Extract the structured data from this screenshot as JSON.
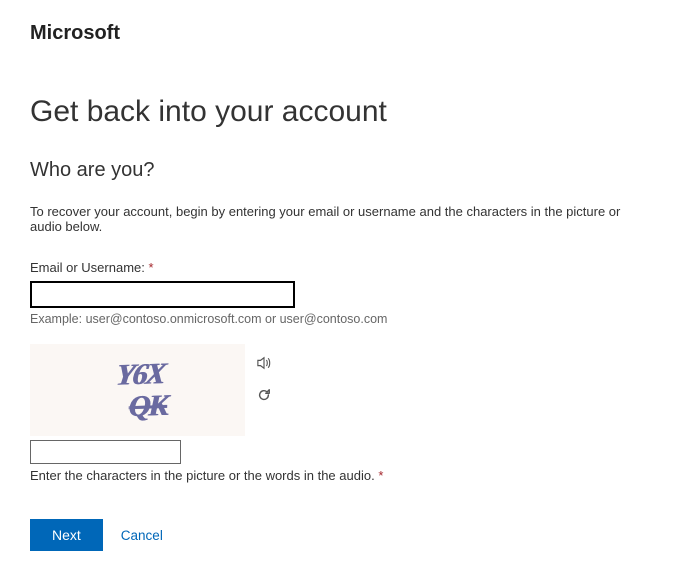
{
  "brand": "Microsoft",
  "page_title": "Get back into your account",
  "subtitle": "Who are you?",
  "instructions": "To recover your account, begin by entering your email or username and the characters in the picture or audio below.",
  "email_field": {
    "label": "Email or Username:",
    "value": "",
    "example": "Example: user@contoso.onmicrosoft.com or user@contoso.com"
  },
  "captcha": {
    "line1": "Y6X",
    "line2": "QK",
    "input_value": "",
    "hint": "Enter the characters in the picture or the words in the audio."
  },
  "required_marker": "*",
  "actions": {
    "next_label": "Next",
    "cancel_label": "Cancel"
  }
}
